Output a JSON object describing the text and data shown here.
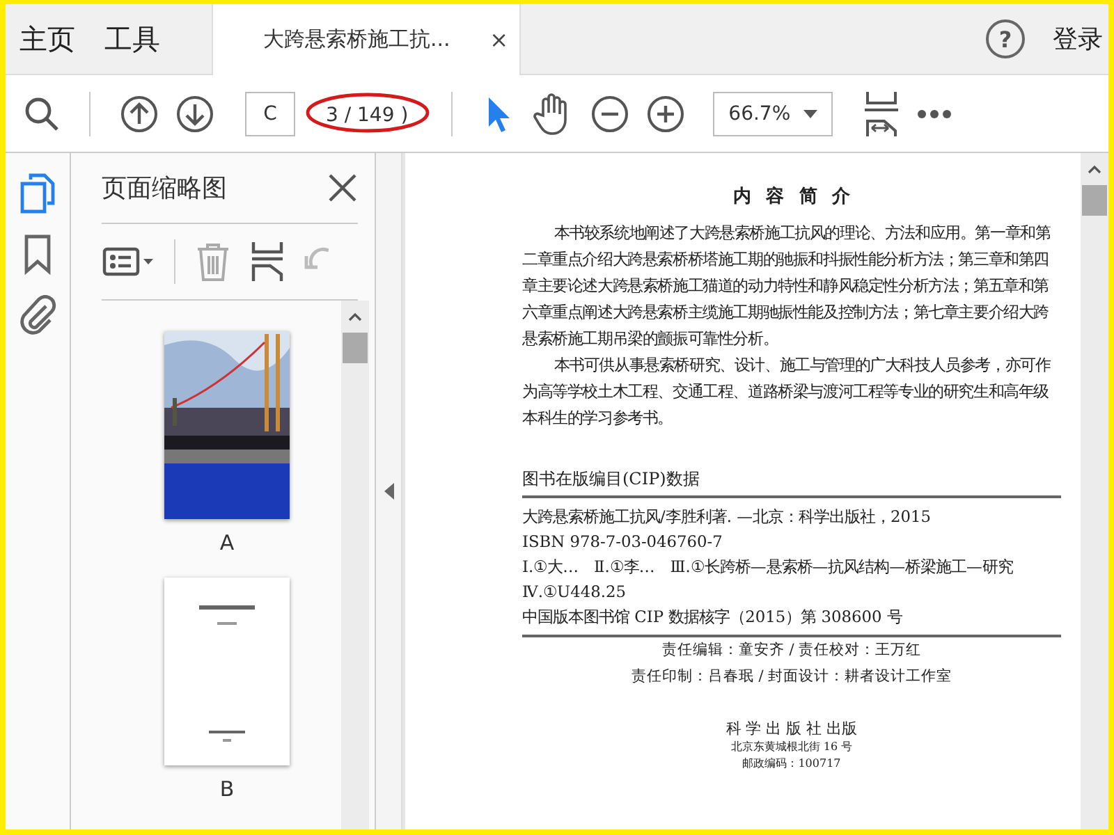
{
  "tabs": [
    {
      "label": "主页",
      "selected": false
    },
    {
      "label": "工具",
      "selected": false
    },
    {
      "label": "大跨悬索桥施工抗...",
      "selected": true,
      "close": "×"
    }
  ],
  "help": "?",
  "sign_in": "登录",
  "toolbar": {
    "page_field": "C",
    "page_count": "3 / 149 )",
    "zoom": "66.7%",
    "tools": [
      {
        "kind": "select",
        "selected": true
      },
      {
        "kind": "hand",
        "selected": false
      }
    ]
  },
  "rail": [
    {
      "kind": "pages",
      "selected": true
    },
    {
      "kind": "bookmark",
      "selected": false
    },
    {
      "kind": "attachment",
      "selected": false
    }
  ],
  "sidebar": {
    "title": "页面缩略图",
    "thumbnails": [
      {
        "label": "A",
        "kind": "cover"
      },
      {
        "label": "B",
        "kind": "title_page"
      }
    ]
  },
  "page": {
    "heading": "内 容 简 介",
    "paragraphs": [
      "本书较系统地阐述了大跨悬索桥施工抗风的理论、方法和应用。第一章和第二章重点介绍大跨悬索桥桥塔施工期的驰振和抖振性能分析方法；第三章和第四章主要论述大跨悬索桥施工猫道的动力特性和静风稳定性分析方法；第五章和第六章重点阐述大跨悬索桥主缆施工期驰振性能及控制方法；第七章主要介绍大跨悬索桥施工期吊梁的颤振可靠性分析。",
      "本书可供从事悬索桥研究、设计、施工与管理的广大科技人员参考，亦可作为高等学校土木工程、交通工程、道路桥梁与渡河工程等专业的研究生和高年级本科生的学习参考书。"
    ],
    "cip_heading": "图书在版编目(CIP)数据",
    "cip_lines": [
      "大跨悬索桥施工抗风/李胜利著. —北京：科学出版社，2015",
      "ISBN 978-7-03-046760-7",
      "Ⅰ.①大…　Ⅱ.①李…　Ⅲ.①长跨桥—悬索桥—抗风结构—桥梁施工—研究　Ⅳ.①U448.25",
      "中国版本图书馆 CIP 数据核字（2015）第 308600 号"
    ],
    "credits": [
      "责任编辑：童安齐 / 责任校对：王万红",
      "责任印制：吕春珉 / 封面设计：耕者设计工作室"
    ],
    "publisher": "科 学 出 版 社 出版",
    "address": "北京东黄城根北街 16 号",
    "postcode": "邮政编码：100717"
  }
}
